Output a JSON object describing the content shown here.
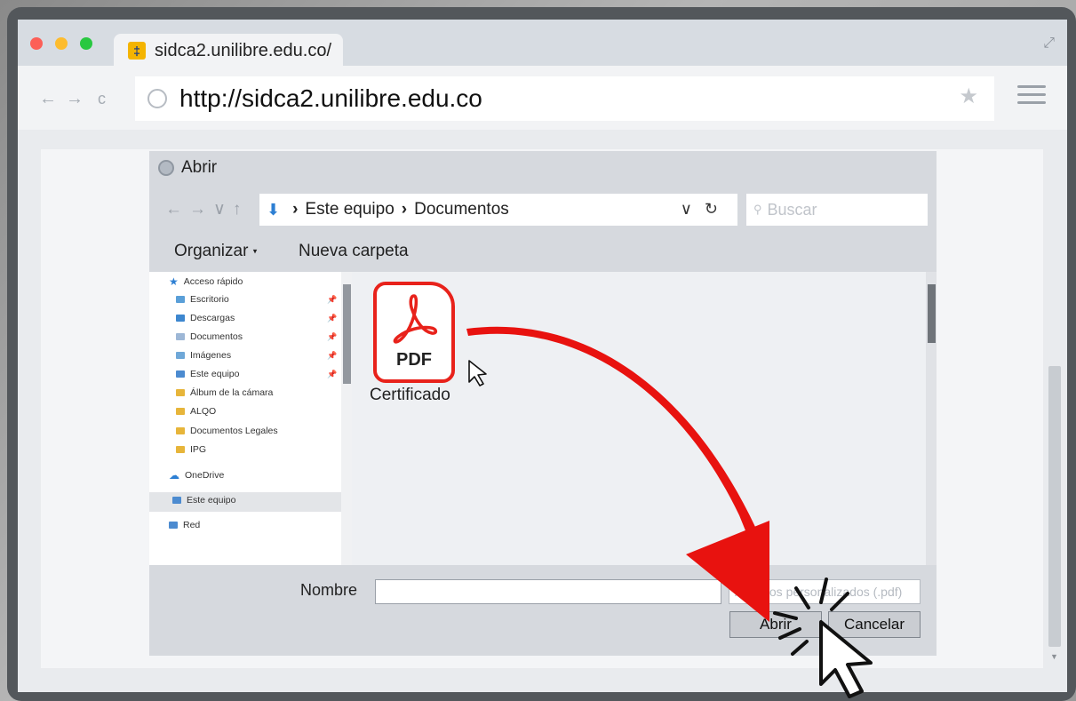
{
  "browser": {
    "tab_title": "sidca2.unilibre.edu.co/",
    "favicon_glyph": "‡",
    "url": "http://sidca2.unilibre.edu.co",
    "icons": [
      "back-icon",
      "forward-icon",
      "reload-icon",
      "globe-icon",
      "star-icon",
      "menu-icon",
      "expand-icon"
    ],
    "traffic_colors": [
      "#fc5f57",
      "#fdbc2e",
      "#28c840"
    ]
  },
  "dialog": {
    "title": "Abrir",
    "path": {
      "segment_1": "Este equipo",
      "segment_2": "Documentos"
    },
    "search_placeholder": "Buscar",
    "commands": {
      "organize": "Organizar",
      "new_folder": "Nueva carpeta"
    },
    "nav_items": {
      "quick_access": "Acceso rápido",
      "desktop": "Escritorio",
      "downloads": "Descargas",
      "documents": "Documentos",
      "images": "Imágenes",
      "this_pc_1": "Este equipo",
      "camera_roll": "Álbum de la cámara",
      "alqo": "ALQO",
      "legal_docs": "Documentos Legales",
      "ipg": "IPG",
      "onedrive": "OneDrive",
      "this_pc_2": "Este equipo",
      "network": "Red"
    },
    "file": {
      "badge": "PDF",
      "name": "Certificado"
    },
    "name_label": "Nombre",
    "name_value": "",
    "file_type_filter": "Archivos personalizados (.pdf)",
    "open_button": "Abrir",
    "cancel_button": "Cancelar"
  },
  "colors": {
    "arrow_red": "#e8120f",
    "pdf_red": "#e8221b"
  }
}
